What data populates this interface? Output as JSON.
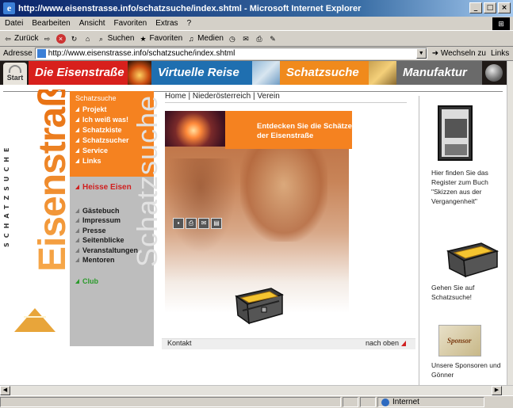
{
  "browser": {
    "title": "http://www.eisenstrasse.info/schatzsuche/index.shtml - Microsoft Internet Explorer",
    "menu": [
      "Datei",
      "Bearbeiten",
      "Ansicht",
      "Favoriten",
      "Extras",
      "?"
    ],
    "toolbar": {
      "back": "Zurück",
      "search": "Suchen",
      "favorites": "Favoriten",
      "media": "Medien"
    },
    "address_label": "Adresse",
    "address_value": "http://www.eisenstrasse.info/schatzsuche/index.shtml",
    "go_label": "Wechseln zu",
    "links_label": "Links",
    "status_zone": "Internet"
  },
  "site": {
    "start_label": "Start",
    "nav": {
      "eisenstrasse": "Die Eisenstraße",
      "reise": "Virtuelle Reise",
      "schatzsuche": "Schatzsuche",
      "manufaktur": "Manufaktur"
    },
    "logo": {
      "main": "Eisenstraße",
      "sub": "SCHATZSUCHE"
    },
    "menu_orange": {
      "head": "Schatzsuche",
      "items": [
        "Projekt",
        "Ich weiß was!",
        "Schatzkiste",
        "Schatzsucher",
        "Service",
        "Links"
      ]
    },
    "menu_grey": {
      "heisse": "Heisse Eisen",
      "items": [
        "Gästebuch",
        "Impressum",
        "Presse",
        "Seitenblicke",
        "Veranstaltungen",
        "Mentoren"
      ],
      "club": "Club"
    },
    "breadcrumb": {
      "home": "Home",
      "region": "Niederösterreich",
      "verein": "Verein",
      "sep": "|"
    },
    "hero": {
      "banner_line1": "Entdecken Sie die Schätze",
      "banner_line2": "der Eisenstraße",
      "vertical_text": "Schatzsuche"
    },
    "footer": {
      "kontakt": "Kontakt",
      "nach_oben": "nach oben"
    },
    "right": {
      "book_text": "Hier finden Sie das Register zum Buch \"Skizzen aus der Vergangenheit\"",
      "chest_text": "Gehen Sie auf Schatzsuche!",
      "sponsor_text": "Unsere Sponsoren und Gönner"
    }
  }
}
